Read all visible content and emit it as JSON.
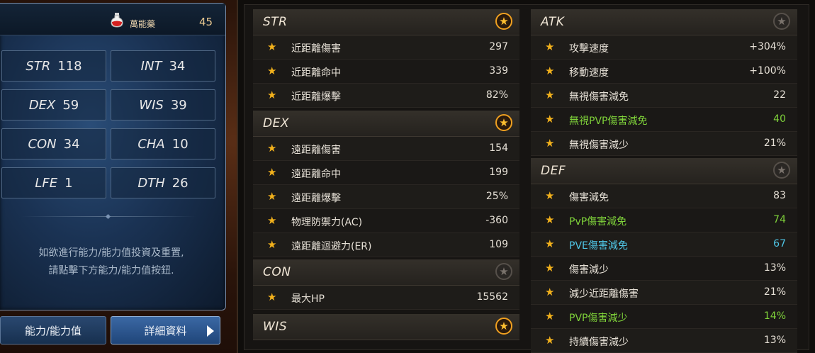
{
  "left_panel": {
    "item": {
      "label": "萬能藥",
      "count": "45",
      "icon": "potion-icon"
    },
    "stats": [
      {
        "name": "STR",
        "value": "118"
      },
      {
        "name": "INT",
        "value": "34"
      },
      {
        "name": "DEX",
        "value": "59"
      },
      {
        "name": "WIS",
        "value": "39"
      },
      {
        "name": "CON",
        "value": "34"
      },
      {
        "name": "CHA",
        "value": "10"
      },
      {
        "name": "LFE",
        "value": "1"
      },
      {
        "name": "DTH",
        "value": "26"
      }
    ],
    "info_line1": "如欲進行能力/能力值投資及重置,",
    "info_line2": "請點擊下方能力/能力值按鈕.",
    "buttons": {
      "ability": "能力/能力值",
      "details": "詳細資料"
    }
  },
  "sections": {
    "str": {
      "title": "STR",
      "starred": true,
      "rows": [
        {
          "label": "近距離傷害",
          "value": "297"
        },
        {
          "label": "近距離命中",
          "value": "339"
        },
        {
          "label": "近距離爆擊",
          "value": "82%"
        }
      ]
    },
    "dex": {
      "title": "DEX",
      "starred": true,
      "rows": [
        {
          "label": "遠距離傷害",
          "value": "154"
        },
        {
          "label": "遠距離命中",
          "value": "199"
        },
        {
          "label": "遠距離爆擊",
          "value": "25%"
        },
        {
          "label": "物理防禦力(AC)",
          "value": "-360"
        },
        {
          "label": "遠距離迴避力(ER)",
          "value": "109"
        }
      ]
    },
    "con": {
      "title": "CON",
      "starred": false,
      "rows": [
        {
          "label": "最大HP",
          "value": "15562"
        }
      ]
    },
    "wis": {
      "title": "WIS",
      "starred": true
    },
    "atk": {
      "title": "ATK",
      "starred": false,
      "rows": [
        {
          "label": "攻擊速度",
          "value": "+304%"
        },
        {
          "label": "移動速度",
          "value": "+100%"
        },
        {
          "label": "無視傷害減免",
          "value": "22"
        },
        {
          "label": "無視PVP傷害減免",
          "value": "40",
          "color": "#7fd23a"
        },
        {
          "label": "無視傷害減少",
          "value": "21%"
        }
      ]
    },
    "def": {
      "title": "DEF",
      "starred": false,
      "rows": [
        {
          "label": "傷害減免",
          "value": "83"
        },
        {
          "label": "PvP傷害減免",
          "value": "74",
          "color": "#7fd23a"
        },
        {
          "label": "PVE傷害減免",
          "value": "67",
          "color": "#4fc6e6"
        },
        {
          "label": "傷害減少",
          "value": "13%"
        },
        {
          "label": "減少近距離傷害",
          "value": "21%"
        },
        {
          "label": "PVP傷害減少",
          "value": "14%",
          "color": "#7fd23a"
        },
        {
          "label": "持續傷害減少",
          "value": "13%"
        }
      ]
    }
  }
}
